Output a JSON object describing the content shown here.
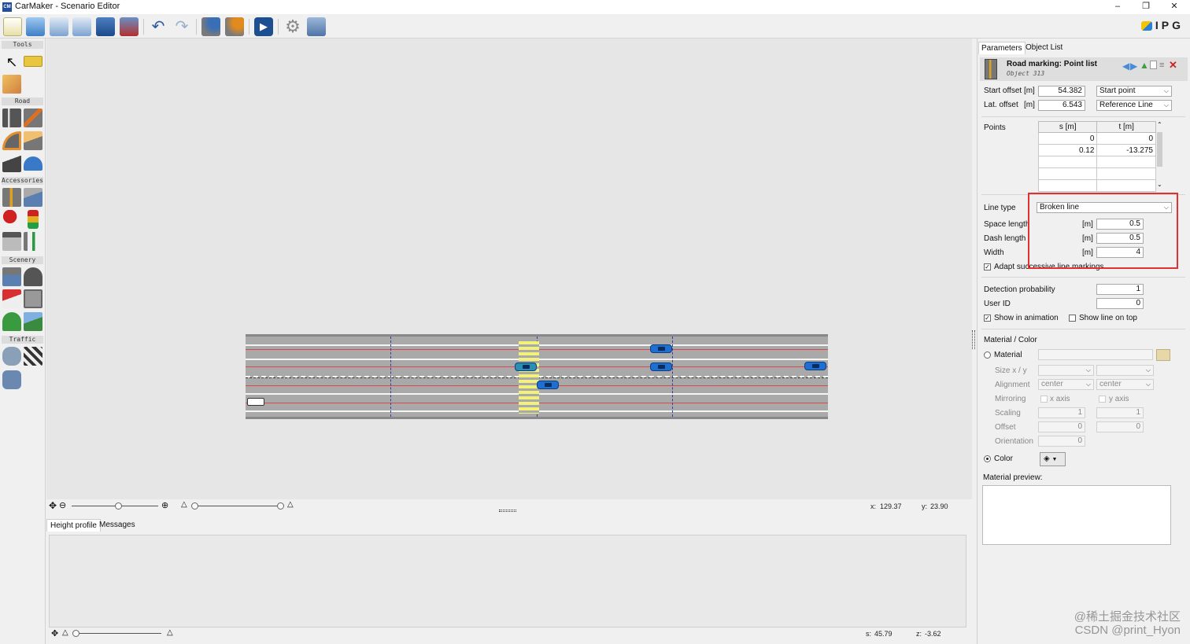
{
  "window": {
    "title": "CarMaker - Scenario Editor",
    "app_icon": "CM",
    "minimize": "–",
    "restore": "❐",
    "close": "✕"
  },
  "toolbar": {
    "buttons": [
      "new-file-icon",
      "open-folder-icon",
      "import-icon",
      "export-icon",
      "save-icon",
      "save-as-icon",
      "undo-icon",
      "redo-icon",
      "road-info-icon",
      "road-check-icon",
      "play-icon",
      "settings-gear-icon",
      "display-icon"
    ],
    "logo_text": "IPG"
  },
  "palette": {
    "sections": [
      "Tools",
      "Road",
      "Accessories",
      "Scenery",
      "Traffic"
    ]
  },
  "canvas": {
    "cars": 6,
    "crosswalk": true
  },
  "zoombar": {
    "x_label": "x:",
    "x_value": "129.37",
    "y_label": "y:",
    "y_value": "23.90"
  },
  "bottom": {
    "tabs": [
      "Height profile",
      "Messages"
    ],
    "s_label": "s:",
    "s_value": "45.79",
    "z_label": "z:",
    "z_value": "-3.62"
  },
  "right": {
    "tabs": [
      "Parameters",
      "Object List"
    ],
    "object": {
      "title": "Road marking: Point list",
      "subtitle": "Object 313"
    },
    "start_offset": {
      "label": "Start offset [m]",
      "value": "54.382",
      "mode": "Start point"
    },
    "lat_offset": {
      "label": "Lat. offset",
      "unit": "[m]",
      "value": "6.543",
      "mode": "Reference Line"
    },
    "points": {
      "label": "Points",
      "headers": [
        "s [m]",
        "t [m]"
      ],
      "rows": [
        [
          "0",
          "0"
        ],
        [
          "0.12",
          "-13.275"
        ],
        [
          "",
          ""
        ],
        [
          "",
          ""
        ],
        [
          "",
          ""
        ]
      ]
    },
    "line_type": {
      "label": "Line type",
      "value": "Broken line"
    },
    "space_length": {
      "label": "Space length",
      "unit": "[m]",
      "value": "0.5"
    },
    "dash_length": {
      "label": "Dash length",
      "unit": "[m]",
      "value": "0.5"
    },
    "width": {
      "label": "Width",
      "unit": "[m]",
      "value": "4"
    },
    "adapt": {
      "label": "Adapt successive line markings",
      "checked": true
    },
    "detection_probability": {
      "label": "Detection probability",
      "value": "1"
    },
    "user_id": {
      "label": "User ID",
      "value": "0"
    },
    "show_in_animation": {
      "label": "Show in animation",
      "checked": true
    },
    "show_line_on_top": {
      "label": "Show line on top",
      "checked": false
    },
    "material_color": {
      "heading": "Material / Color",
      "material_label": "Material",
      "size_label": "Size x / y",
      "alignment_label": "Alignment",
      "alignment_x": "center",
      "alignment_y": "center",
      "mirroring_label": "Mirroring",
      "x_axis": "x axis",
      "y_axis": "y axis",
      "scaling_label": "Scaling",
      "scaling_x": "1",
      "scaling_y": "1",
      "offset_label": "Offset",
      "offset_x": "0",
      "offset_y": "0",
      "orientation_label": "Orientation",
      "orientation": "0",
      "color_label": "Color",
      "preview_label": "Material preview:"
    }
  },
  "watermark": {
    "line1": "@稀土掘金技术社区",
    "line2": "CSDN @print_Hyon"
  },
  "colors": {
    "highlight": "#e03030",
    "car": "#1e6fd0",
    "crosswalk": "#f2f27a"
  }
}
